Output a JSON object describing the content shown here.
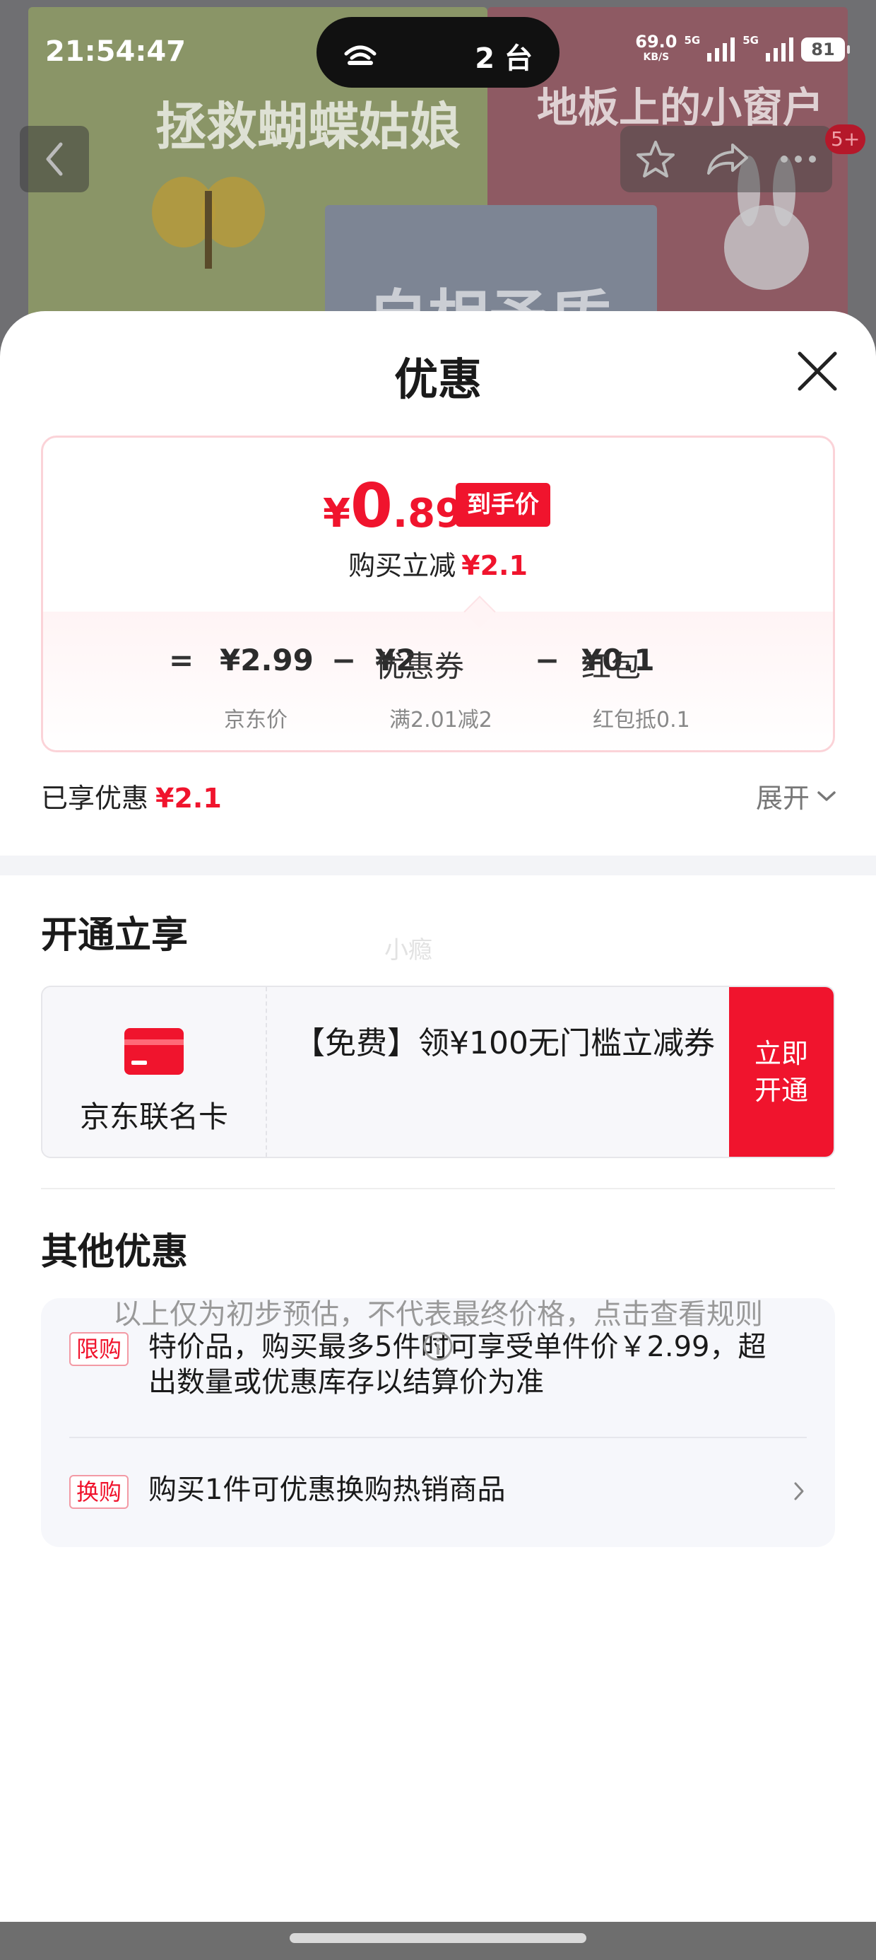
{
  "status_bar": {
    "time": "21:54:47",
    "island_count": "2 台",
    "net_speed": "69.0",
    "net_speed_unit": "KB/S",
    "signal_label_1": "5G",
    "signal_label_2": "5G",
    "battery": "81"
  },
  "background": {
    "book_title_a": "拯救蝴蝶姑娘",
    "book_title_b": "地板上的小窗户",
    "book_title_c": "自相矛盾",
    "cart_badge": "5+"
  },
  "sheet": {
    "title": "优惠",
    "final_price_symbol": "¥",
    "final_price_int": "0",
    "final_price_dec": ".89",
    "final_price_tag": "到手价",
    "reduce_label": "购买立减",
    "reduce_amount": "¥2.1",
    "formula": {
      "equals": "=",
      "jd_price": "¥2.99",
      "minus": "−",
      "coupon_label": "优惠券",
      "coupon_value": "¥2",
      "packet_label": "红包",
      "packet_value": "¥0.1"
    },
    "sublabels": {
      "jd_price_label": "京东价",
      "coupon_rule": "满2.01减2",
      "packet_rule": "红包抵0.1"
    },
    "enjoyed_label": "已享优惠",
    "enjoyed_amount": "¥2.1",
    "expand_label": "展开"
  },
  "open_section": {
    "title": "开通立享",
    "watermark": "小瘾",
    "card_name": "京东联名卡",
    "card_desc": "【免费】领¥100无门槛立减券",
    "open_button": "立即开通"
  },
  "other_section": {
    "title": "其他优惠",
    "promos": [
      {
        "tag": "限购",
        "text": "特价品，购买最多5件时可享受单件价￥2.99，超出数量或优惠库存以结算价为准"
      },
      {
        "tag": "换购",
        "text": "购买1件可优惠换购热销商品"
      }
    ]
  },
  "footer": {
    "disclaimer": "以上仅为初步预估，不代表最终价格，点击查看规则"
  },
  "colors": {
    "accent_red": "#f0142d",
    "tag_border": "#f39aa5",
    "muted_gray": "#999999"
  }
}
